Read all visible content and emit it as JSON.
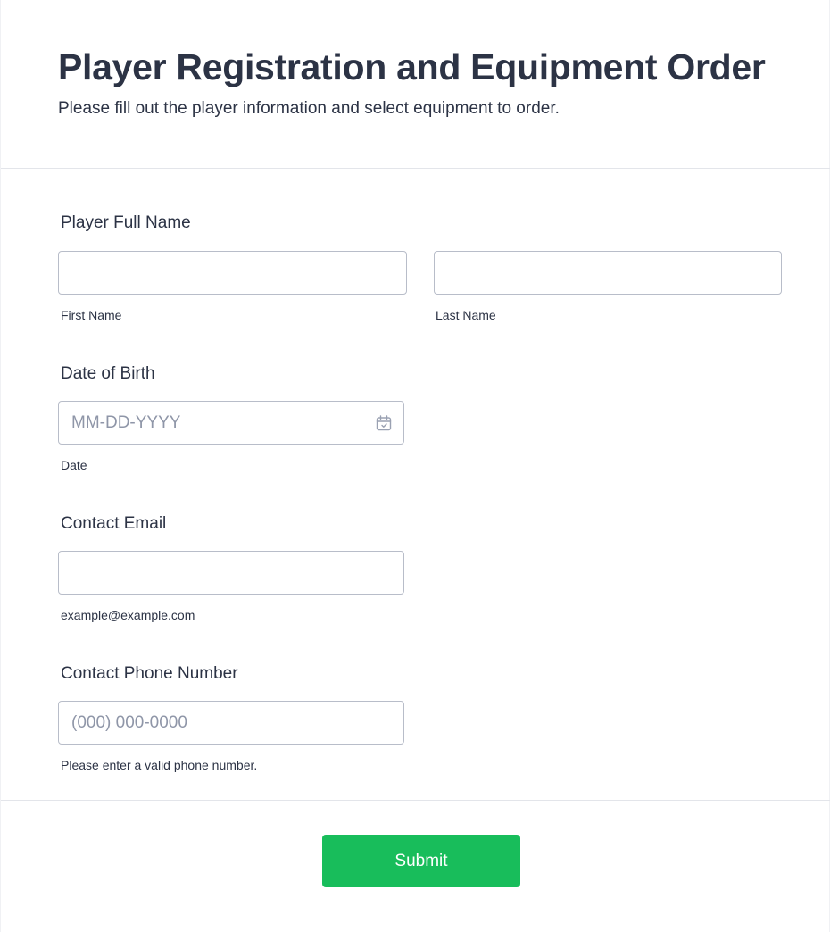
{
  "header": {
    "title": "Player Registration and Equipment Order",
    "subtitle": "Please fill out the player information and select equipment to order."
  },
  "fields": {
    "full_name": {
      "label": "Player Full Name",
      "first_sublabel": "First Name",
      "last_sublabel": "Last Name",
      "first_value": "",
      "last_value": ""
    },
    "dob": {
      "label": "Date of Birth",
      "placeholder": "MM-DD-YYYY",
      "sublabel": "Date",
      "icon": "calendar-icon"
    },
    "email": {
      "label": "Contact Email",
      "sublabel": "example@example.com",
      "value": ""
    },
    "phone": {
      "label": "Contact Phone Number",
      "placeholder": "(000) 000-0000",
      "sublabel": "Please enter a valid phone number."
    }
  },
  "submit": {
    "label": "Submit",
    "color": "#18bd5b"
  }
}
